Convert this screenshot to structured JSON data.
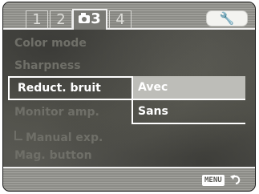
{
  "tabs": [
    {
      "label": "1"
    },
    {
      "label": "2"
    },
    {
      "label": "3",
      "icon": "camera-icon",
      "active": true
    },
    {
      "label": "4"
    }
  ],
  "setup_tab": {
    "icon": "wrench-icon",
    "glyph": "🔧"
  },
  "menu": {
    "items": [
      {
        "label": "Color mode"
      },
      {
        "label": "Sharpness"
      },
      {
        "label": "Reduct. bruit",
        "selected": true
      },
      {
        "label": "Monitor amp."
      },
      {
        "label": "Manual exp.",
        "sub": true
      },
      {
        "label": "Mag. button"
      }
    ]
  },
  "options": [
    {
      "label": "Avec",
      "selected": true
    },
    {
      "label": "Sans"
    }
  ],
  "footer": {
    "menu_label": "MENU",
    "return_icon": "return-arrow-icon"
  },
  "colors": {
    "highlight": "#bdbdb8",
    "border": "#ffffff",
    "dim_text": "#6f6f68"
  }
}
